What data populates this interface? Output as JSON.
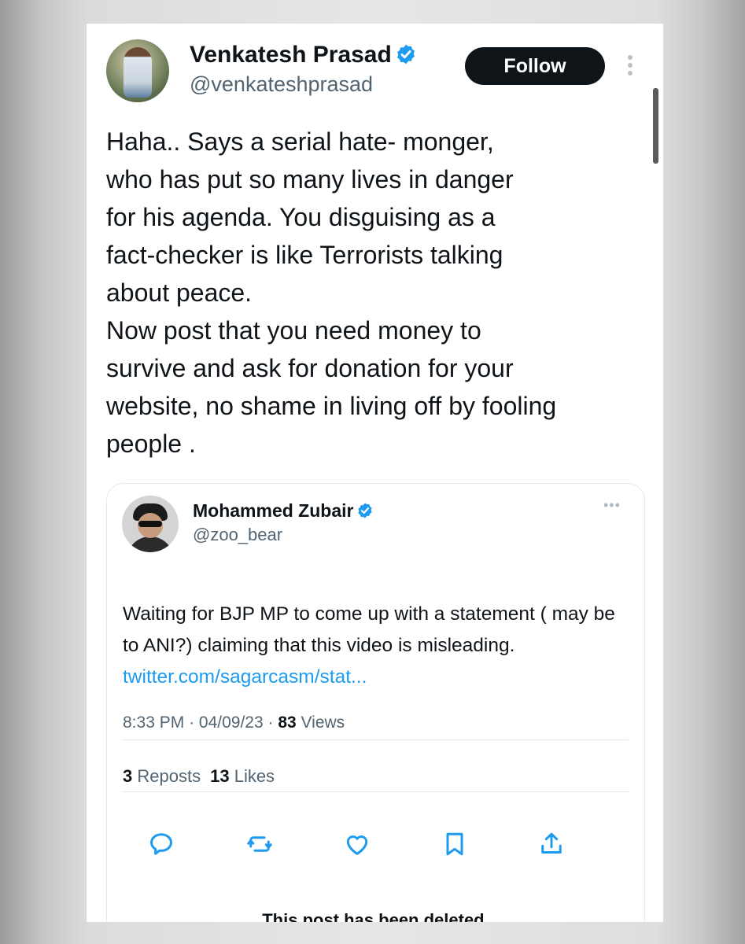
{
  "tweet": {
    "author_name": "Venkatesh Prasad",
    "author_handle": "@venkateshprasad",
    "follow_label": "Follow",
    "text": "Haha.. Says a serial hate- monger,\nwho has put so many lives in danger\nfor his agenda. You disguising as a\nfact-checker is like Terrorists talking\nabout peace.\nNow post that you need money to\nsurvive and ask for donation for your\nwebsite, no shame in living off by fooling\npeople ."
  },
  "quoted_tweet": {
    "author_name": "Mohammed Zubair",
    "author_handle": "@zoo_bear",
    "text": "Waiting for BJP MP to come up with a statement ( may be to ANI?) claiming that this video is misleading.",
    "link": "twitter.com/sagarcasm/stat...",
    "time": "8:33 PM",
    "date": "04/09/23",
    "separator": "·",
    "views_count": "83",
    "views_label": "Views",
    "reposts_count": "3",
    "reposts_label": "Reposts",
    "likes_count": "13",
    "likes_label": "Likes",
    "actions": [
      "reply-icon",
      "repost-icon",
      "like-icon",
      "bookmark-icon",
      "share-icon"
    ],
    "deleted_notice": "This post has been deleted."
  },
  "colors": {
    "verified": "#1d9bf0",
    "link": "#1d9bf0",
    "text_primary": "#0f1419",
    "text_secondary": "#536471",
    "button_bg": "#0f1419"
  }
}
